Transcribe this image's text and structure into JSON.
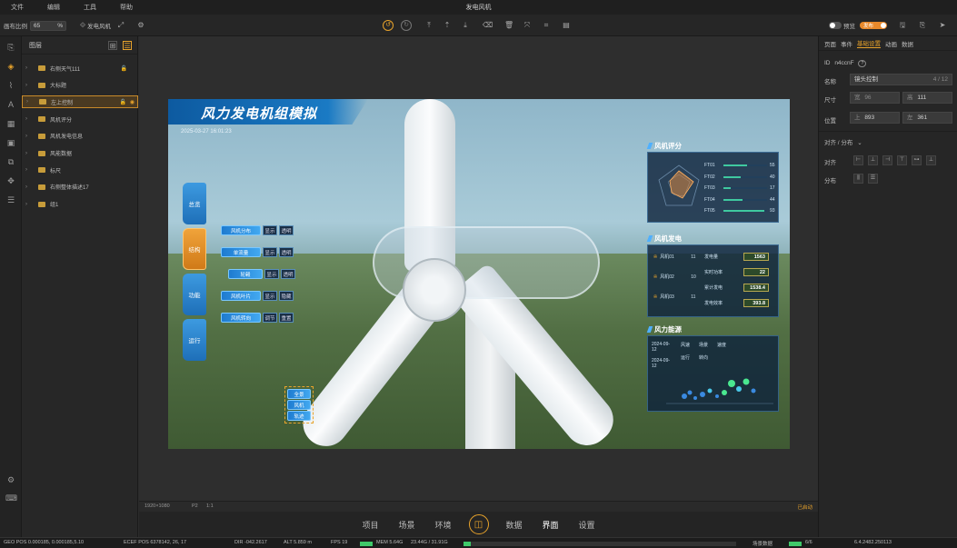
{
  "menu": {
    "items": [
      "文件",
      "编辑",
      "工具",
      "帮助"
    ],
    "app_title": "发电风机"
  },
  "toolbar": {
    "zoom_label": "画布比例",
    "zoom_value": "65",
    "zoom_unit": "%",
    "scene_label": "发电风机",
    "toggle_preview": "预览",
    "toggle_publish": "发布"
  },
  "layers": {
    "title": "图层",
    "items": [
      {
        "label": "右侧天气111",
        "locked": true
      },
      {
        "label": "大标题",
        "locked": false
      },
      {
        "label": "左上控制",
        "locked": true,
        "selected": true
      },
      {
        "label": "风机评分",
        "locked": false
      },
      {
        "label": "风机发电信息",
        "locked": false
      },
      {
        "label": "风能数据",
        "locked": false
      },
      {
        "label": "标尺",
        "locked": false
      },
      {
        "label": "右侧整体描述17",
        "locked": false
      },
      {
        "label": "组1",
        "locked": false
      }
    ]
  },
  "scene": {
    "title": "风力发电机组模拟",
    "datetime": "2025-03-27 16:01:23",
    "side_tabs": [
      "总览",
      "结构",
      "功能",
      "运行"
    ],
    "controls": [
      {
        "label": "风机分布",
        "show": "显示",
        "alt": "透明"
      },
      {
        "label": "单流量",
        "show": "显示",
        "alt": "透明"
      },
      {
        "label": "轮毂",
        "show": "显示",
        "alt": "透明"
      },
      {
        "label": "风机叶片",
        "show": "显示",
        "alt": "隐藏"
      },
      {
        "label": "风机转向",
        "show": "调节",
        "alt": "重置"
      }
    ],
    "mini_controls": [
      "全景",
      "风机",
      "轨迹"
    ],
    "score_panel": {
      "title": "风机评分",
      "rows": [
        {
          "label": "FT01",
          "value": "55",
          "fill": 0.55
        },
        {
          "label": "FT02",
          "value": "40",
          "fill": 0.4
        },
        {
          "label": "FT03",
          "value": "17",
          "fill": 0.17
        },
        {
          "label": "FT04",
          "value": "44",
          "fill": 0.44
        },
        {
          "label": "FT05",
          "value": "93",
          "fill": 0.93
        }
      ]
    },
    "power_panel": {
      "title": "风机发电",
      "left": [
        {
          "name": "风机01",
          "value": "11"
        },
        {
          "name": "风机02",
          "value": "10"
        },
        {
          "name": "风机03",
          "value": "11"
        }
      ],
      "right": [
        {
          "label": "发电量",
          "value": "1563"
        },
        {
          "label": "实时功率",
          "value": "22"
        },
        {
          "label": "累计发电",
          "value": "1538.4"
        },
        {
          "label": "发电效率",
          "value": "393.8"
        }
      ]
    },
    "energy_panel": {
      "title": "风力能源",
      "date1": "2024-09-12",
      "date2": "2024-09-12",
      "tags": [
        "风速",
        "场景",
        "速度",
        "运行",
        "转向"
      ]
    }
  },
  "canvas_status": {
    "size": "1920×1080",
    "page": "P2",
    "zoom": "1:1",
    "right": "已启动"
  },
  "bottom_nav": [
    "项目",
    "场景",
    "环境",
    "数据",
    "界面",
    "设置"
  ],
  "right_panel": {
    "tabs": [
      "页面",
      "事件",
      "基础设置",
      "动画",
      "数据"
    ],
    "id_label": "ID",
    "id_value": "n4ccnF",
    "name_label": "名称",
    "name_value": "镜头控制",
    "name_count": "4 / 12",
    "size_label": "尺寸",
    "width_label": "宽",
    "width_value": "96",
    "height_label": "高",
    "height_value": "111",
    "pos_label": "位置",
    "top_label": "上",
    "top_value": "893",
    "left_label": "左",
    "left_value": "361",
    "align_section": "对齐 / 分布",
    "align_label": "对齐",
    "dist_label": "分布"
  },
  "statusbar": {
    "geo_pos": "GEO POS  0.000185, 0.000185,5.10",
    "ecef": "ECEF POS  6378142, 26, 17",
    "dir": "DIR  -042.2617",
    "alt": "ALT  5.859 m",
    "fps": "FPS  19",
    "mem": "MEM  5.64G",
    "mem2": "23.44G / 31.91G",
    "scene": "场景数据",
    "count": "6/6",
    "coords": "6.4.2482.250113"
  }
}
